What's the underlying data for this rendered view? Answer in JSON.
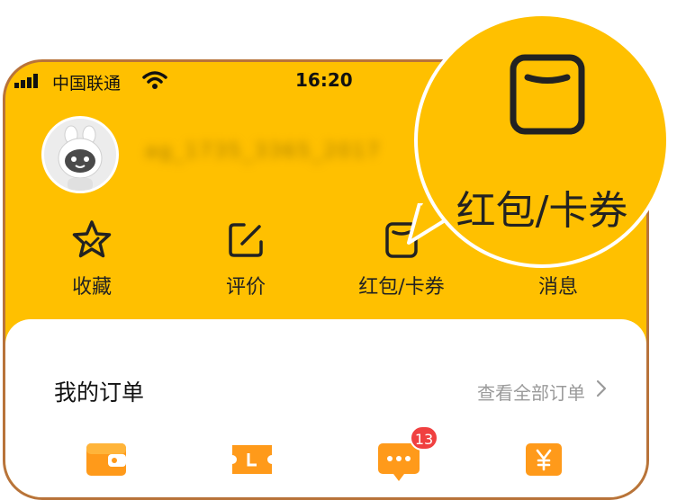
{
  "status_bar": {
    "carrier": "中国联通",
    "time": "16:20"
  },
  "profile": {
    "name_blurred": "ag_1735_3365_2017"
  },
  "shortcuts": [
    {
      "label": "收藏",
      "icon": "star-icon"
    },
    {
      "label": "评价",
      "icon": "edit-icon"
    },
    {
      "label": "红包/卡券",
      "icon": "wallet-icon"
    },
    {
      "label": "消息",
      "icon": "message-icon"
    }
  ],
  "orders": {
    "title": "我的订单",
    "view_all": "查看全部订单",
    "icons": [
      "wallet-icon",
      "ticket-icon",
      "chat-icon",
      "yuan-icon"
    ],
    "badge": "13"
  },
  "magnifier": {
    "label": "红包/卡券",
    "icon": "wallet-icon"
  },
  "colors": {
    "background": "#ffc000",
    "accent": "#ff9a1a",
    "badge": "#f04040",
    "frame": "#b8733a"
  }
}
